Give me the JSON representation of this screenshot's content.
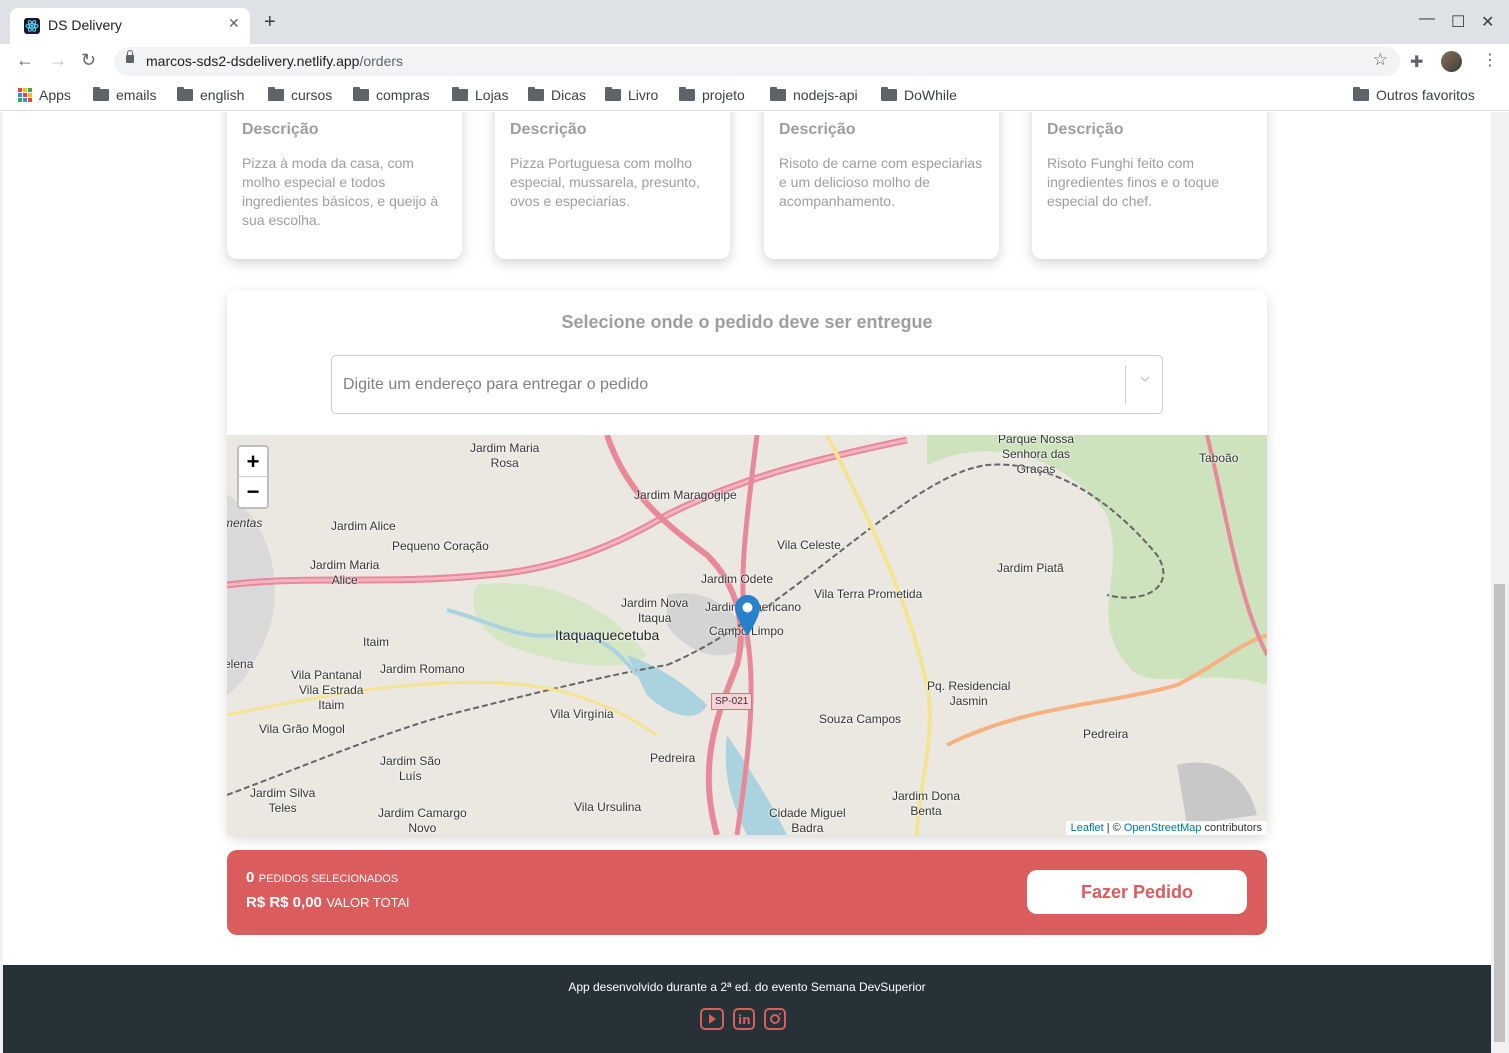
{
  "browser": {
    "tab_title": "DS Delivery",
    "tab_close": "✕",
    "new_tab": "+",
    "url_host": "marcos-sds2-dsdelivery.netlify.app",
    "url_path": "/orders",
    "bookmarks": [
      "Apps",
      "emails",
      "english",
      "cursos",
      "compras",
      "Lojas",
      "Dicas",
      "Livro",
      "projeto",
      "nodejs-api",
      "DoWhile"
    ],
    "other_bookmarks": "Outros favoritos"
  },
  "products": [
    {
      "heading": "Descrição",
      "description": "Pizza à moda da casa, com molho especial e todos ingredientes básicos, e queijo à sua escolha."
    },
    {
      "heading": "Descrição",
      "description": "Pizza Portuguesa com molho especial, mussarela, presunto, ovos e especiarias."
    },
    {
      "heading": "Descrição",
      "description": "Risoto de carne com especiarias e um delicioso molho de acompanhamento."
    },
    {
      "heading": "Descrição",
      "description": "Risoto Funghi feito com ingredientes finos e o toque especial do chef."
    }
  ],
  "delivery": {
    "title": "Selecione onde o pedido deve ser entregue",
    "address_placeholder": "Digite um endereço para entregar o pedido"
  },
  "map": {
    "zoom_in": "+",
    "zoom_out": "−",
    "attribution_leaflet": "Leaflet",
    "attribution_sep": " | © ",
    "attribution_osm": "OpenStreetMap",
    "attribution_tail": " contributors",
    "labels": {
      "jardim_maria_rosa": "Jardim Maria\nRosa",
      "jardim_maragogipe": "Jardim Maragogipe",
      "jardim_alice": "Jardim Alice",
      "pequeno_coracao": "Pequeno Coração",
      "jardim_maria_alice": "Jardim Maria\nAlice",
      "jardim_nova_itaqua": "Jardim Nova\nItaqua",
      "itaquaquecetuba": "Itaquaquecetuba",
      "itaim": "Itaim",
      "jardim_romano": "Jardim Romano",
      "vila_pantanal": "Vila Pantanal",
      "vila_estrada_itaim": "Vila Estrada\nItaim",
      "vila_grao_mogol": "Vila Grão Mogol",
      "vila_virginia": "Vila Virgínia",
      "pedreira": "Pedreira",
      "jardim_sao_luis": "Jardim São\nLuís",
      "jardim_silva_teles": "Jardim Silva\nTeles",
      "jardim_camargo_novo": "Jardim Camargo\nNovo",
      "vila_ursulina": "Vila Ursulina",
      "cidade_miguel_badra": "Cidade Miguel\nBadra",
      "vila_celeste": "Vila Celeste",
      "jardim_odete": "Jardim Odete",
      "jardim_americano": "Jardim Americano",
      "campo_limpo": "Campo Limpo",
      "vila_terra_prometida": "Vila Terra Prometida",
      "souza_campos": "Souza Campos",
      "pq_residencial_jasmin": "Pq. Residencial\nJasmin",
      "jardim_dona_benta": "Jardim Dona\nBenta",
      "jardim_piata": "Jardim Piatã",
      "parque_nossa_senhora": "Parque Nossa\nSenhora das\nGraças",
      "taboao": "Taboão",
      "pedreira_east": "Pedreira",
      "sp021": "SP-021",
      "mentas": "mentas",
      "elena": "elena"
    }
  },
  "summary": {
    "count": "0",
    "count_label": "PEDIDOS SELECIONADOS",
    "amount": "R$ R$ 0,00",
    "amount_label": "VALOR TOTAl",
    "order_button": "Fazer Pedido"
  },
  "footer": {
    "text": "App desenvolvido durante a 2ª ed. do evento Semana DevSuperior",
    "icons": [
      "youtube-icon",
      "linkedin-icon",
      "instagram-icon"
    ]
  },
  "colors": {
    "primary": "#DA5C5C",
    "footer_bg": "#263238",
    "muted_text": "#9E9E9E"
  }
}
